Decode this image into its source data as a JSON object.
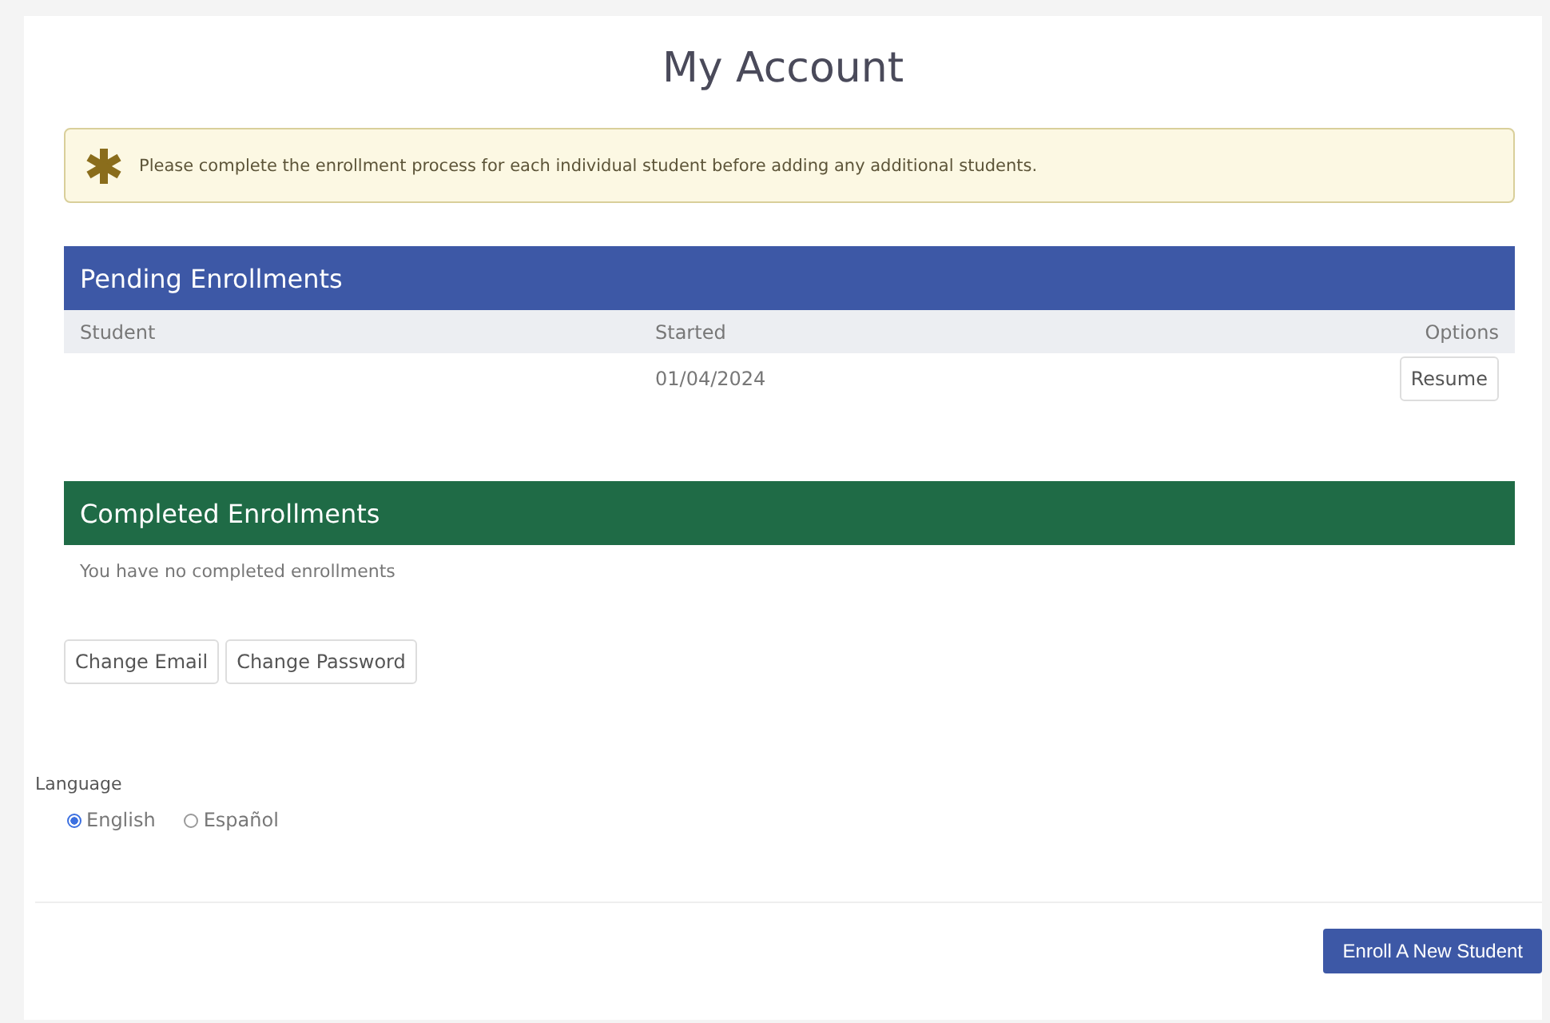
{
  "title": "My Account",
  "alert": {
    "text": "Please complete the enrollment process for each individual student before adding any additional students."
  },
  "pending": {
    "title": "Pending Enrollments",
    "columns": [
      "Student",
      "Started",
      "Options"
    ],
    "rows": [
      {
        "started": "01/04/2024",
        "action": "Resume"
      }
    ]
  },
  "completed": {
    "title": "Completed Enrollments",
    "empty_text": "You have no completed enrollments"
  },
  "account_buttons": [
    "Change Email",
    "Change Password"
  ],
  "language": {
    "label": "Language",
    "options": [
      {
        "label": "English",
        "selected": true
      },
      {
        "label": "Español",
        "selected": false
      }
    ]
  },
  "footer_button": "Enroll A New Student"
}
